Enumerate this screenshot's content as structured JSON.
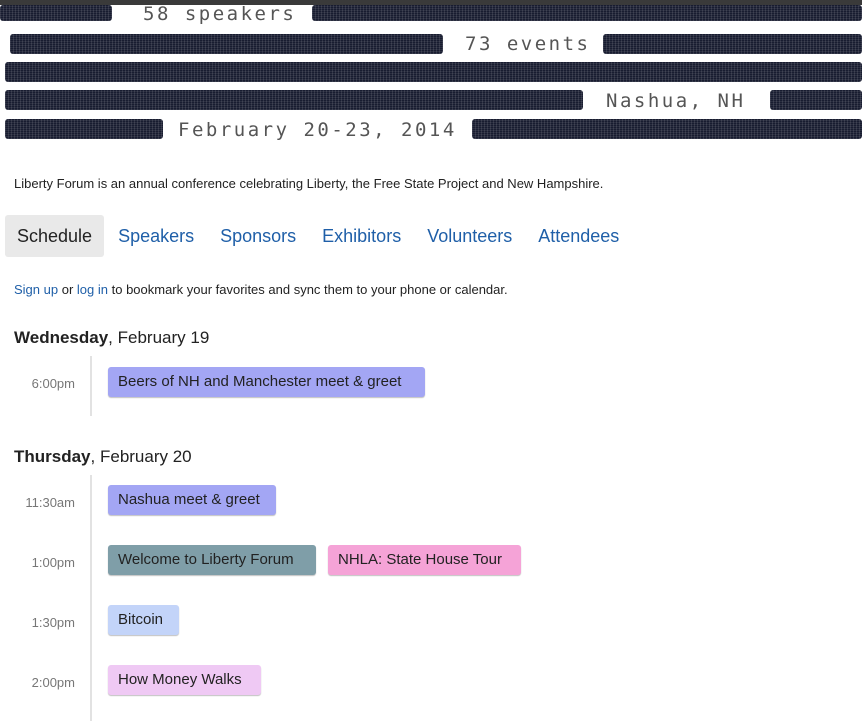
{
  "banner": {
    "speakers": "58 speakers",
    "events": "73 events",
    "location": "Nashua, NH",
    "dates": "February 20-23, 2014"
  },
  "intro": "Liberty Forum is an annual conference celebrating Liberty, the Free State Project and New Hampshire.",
  "tabs": [
    "Schedule",
    "Speakers",
    "Sponsors",
    "Exhibitors",
    "Volunteers",
    "Attendees"
  ],
  "signup": {
    "signup_link": "Sign up",
    "or": "or",
    "login_link": "log in",
    "rest": "to bookmark your favorites and sync them to your phone or calendar."
  },
  "days": [
    {
      "weekday": "Wednesday",
      "date": ", February 19",
      "slots": [
        {
          "time": "6:00pm",
          "events": [
            {
              "title": "Beers of NH and Manchester meet & greet",
              "color": "#a3a6f4"
            }
          ]
        }
      ]
    },
    {
      "weekday": "Thursday",
      "date": ", February 20",
      "slots": [
        {
          "time": "11:30am",
          "events": [
            {
              "title": "Nashua meet & greet",
              "color": "#a3a6f4"
            }
          ]
        },
        {
          "time": "1:00pm",
          "events": [
            {
              "title": "Welcome to Liberty Forum",
              "color": "#7f9ea8"
            },
            {
              "title": "NHLA: State House Tour",
              "color": "#f5a3d7"
            }
          ]
        },
        {
          "time": "1:30pm",
          "events": [
            {
              "title": "Bitcoin",
              "color": "#c3d4f9"
            }
          ]
        },
        {
          "time": "2:00pm",
          "events": [
            {
              "title": "How Money Walks",
              "color": "#efc9f4"
            }
          ]
        }
      ]
    }
  ]
}
